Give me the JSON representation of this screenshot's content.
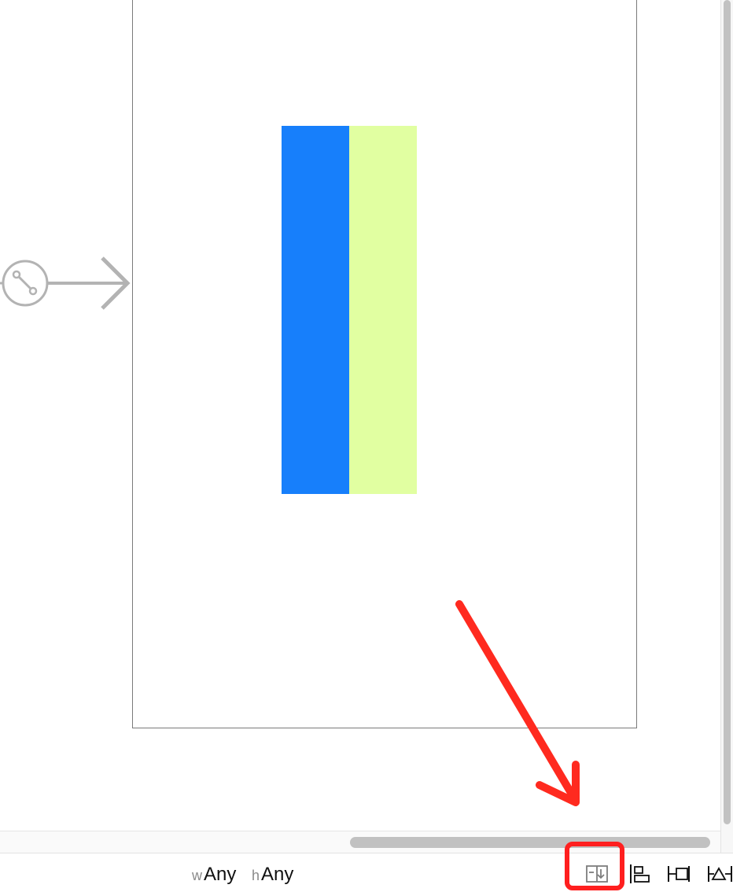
{
  "canvas": {
    "views": [
      {
        "name": "blue-view",
        "color": "#177ffb"
      },
      {
        "name": "light-green-view",
        "color": "#e1ffa1"
      }
    ],
    "entry_point_icon": "segue-entry-arrow-icon",
    "annotation_color": "#ff2a1f"
  },
  "bottom_bar": {
    "width_class": {
      "prefix": "w",
      "value": "Any"
    },
    "height_class": {
      "prefix": "h",
      "value": "Any"
    },
    "tools": [
      {
        "icon": "update-frames-icon",
        "highlighted": true
      },
      {
        "icon": "align-icon"
      },
      {
        "icon": "pin-icon"
      },
      {
        "icon": "resolve-auto-layout-issues-icon"
      }
    ]
  }
}
